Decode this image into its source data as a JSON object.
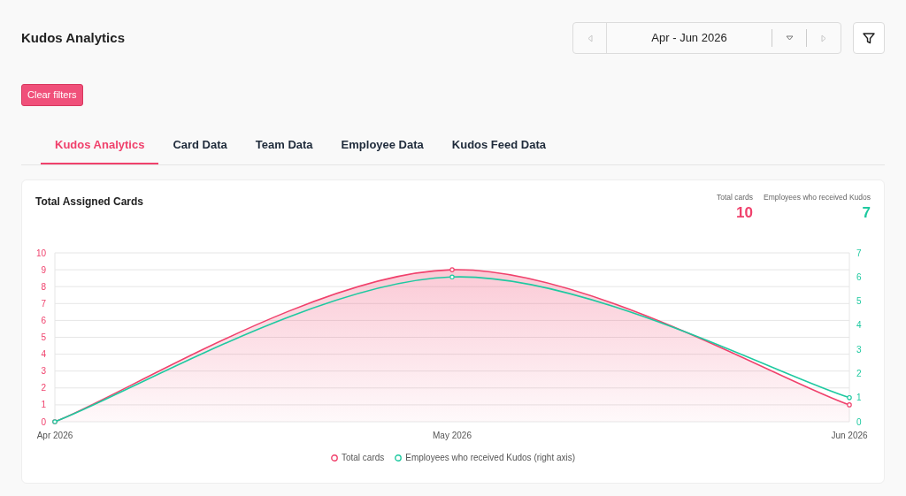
{
  "header": {
    "title": "Kudos Analytics"
  },
  "date_picker": {
    "label": "Apr - Jun 2026",
    "prev_disabled": true,
    "next_disabled": true
  },
  "clear_filters": "Clear filters",
  "tabs": [
    {
      "label": "Kudos Analytics",
      "selected": true
    },
    {
      "label": "Card Data",
      "selected": false
    },
    {
      "label": "Team Data",
      "selected": false
    },
    {
      "label": "Employee Data",
      "selected": false
    },
    {
      "label": "Kudos Feed Data",
      "selected": false
    }
  ],
  "card": {
    "title": "Total Assigned Cards",
    "stats": [
      {
        "label": "Total cards",
        "value": "10",
        "color": "#f0416c"
      },
      {
        "label": "Employees who received Kudos",
        "value": "7",
        "color": "#1ec9a0"
      }
    ],
    "chart_data": {
      "type": "area",
      "categories": [
        "Apr 2026",
        "May 2026",
        "Jun 2026"
      ],
      "series": [
        {
          "name": "Total cards",
          "color": "#f0416c",
          "axis": "y",
          "type": "area",
          "marker": "circle",
          "values": [
            0,
            9,
            1
          ]
        },
        {
          "name": "Employees who received Kudos (right axis)",
          "color": "#1ec9a0",
          "axis": "y2",
          "type": "line",
          "marker": "circle",
          "values": [
            0,
            6,
            1
          ]
        }
      ],
      "grid": true,
      "legend": "bottom",
      "ylim": [
        0,
        10
      ],
      "yticks": [
        0,
        1,
        2,
        3,
        4,
        5,
        6,
        7,
        8,
        9,
        10
      ],
      "y2lim": [
        0,
        7
      ],
      "y2ticks": [
        0,
        1,
        2,
        3,
        4,
        5,
        6,
        7
      ]
    }
  }
}
